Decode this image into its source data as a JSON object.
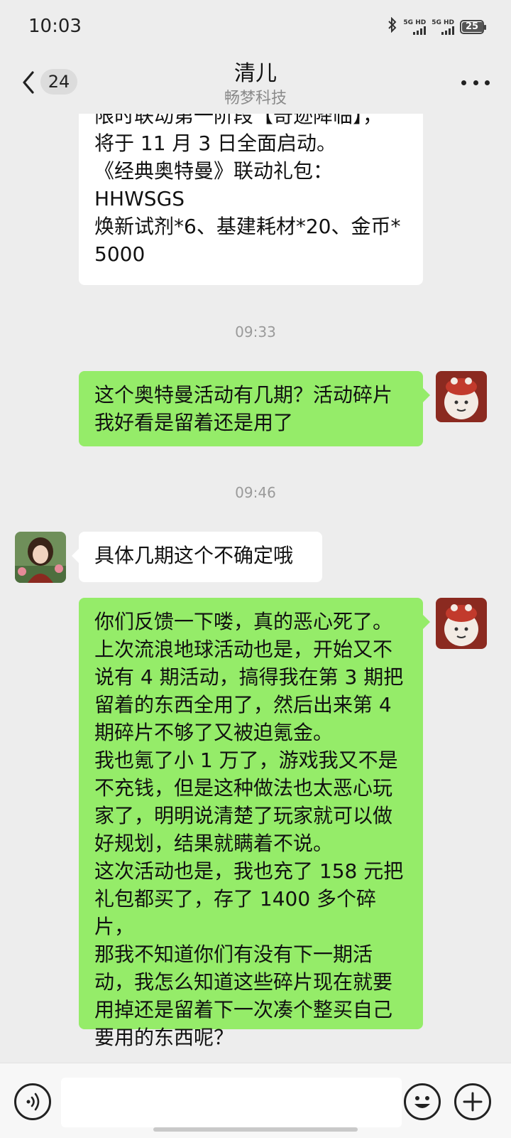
{
  "status_bar": {
    "time": "10:03",
    "sim1_label": "5G HD",
    "sim2_label": "5G HD",
    "battery": "25",
    "icons": [
      "bluetooth-icon",
      "signal-icon",
      "battery-icon"
    ]
  },
  "header": {
    "unread_count": "24",
    "title": "清儿",
    "subtitle": "畅梦科技"
  },
  "messages": {
    "m1": {
      "side": "left",
      "text": "限时联动第一阶段【奇迹降临】，\n将于 11 月 3 日全面启动。\n《经典奥特曼》联动礼包：\nHHWSGS\n焕新试剂*6、基建耗材*20、金币*\n5000"
    },
    "ts1": "09:33",
    "m2": {
      "side": "right",
      "text": "这个奥特曼活动有几期？活动碎片\n我好看是留着还是用了"
    },
    "ts2": "09:46",
    "m3": {
      "side": "left",
      "text": "具体几期这个不确定哦"
    },
    "m4": {
      "side": "right",
      "text": "你们反馈一下喽，真的恶心死了。\n上次流浪地球活动也是，开始又不\n说有 4 期活动，搞得我在第 3 期把\n留着的东西全用了，然后出来第 4\n期碎片不够了又被迫氪金。\n我也氪了小 1 万了，游戏我又不是\n不充钱，但是这种做法也太恶心玩\n家了，明明说清楚了玩家就可以做\n好规划，结果就瞒着不说。\n这次活动也是，我也充了 158 元把\n礼包都买了，存了 1400 多个碎片，\n那我不知道你们有没有下一期活\n动，我怎么知道这些碎片现在就要\n用掉还是留着下一次凑个整买自己\n要用的东西呢？"
    }
  },
  "colors": {
    "background": "#ededed",
    "sent_bubble": "#95ec69",
    "received_bubble": "#ffffff"
  },
  "input_bar": {
    "voice_icon": "voice-icon",
    "emoji_icon": "emoji-icon",
    "plus_icon": "plus-icon"
  }
}
